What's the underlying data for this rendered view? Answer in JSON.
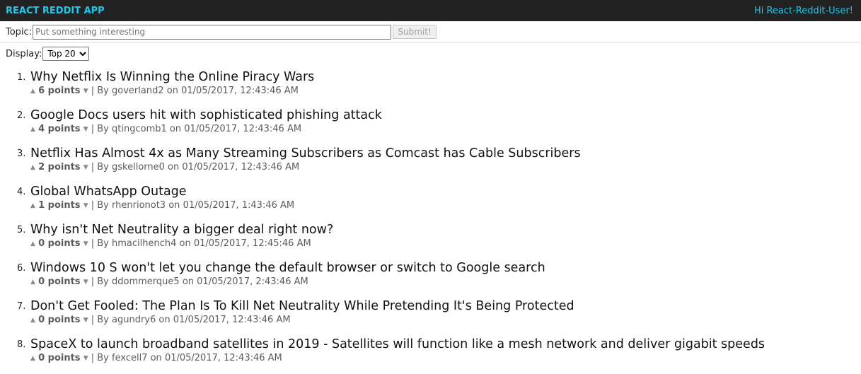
{
  "header": {
    "brand": "REACT REDDIT APP",
    "greeting": "Hi React-Reddit-User!",
    "accent_color": "#1ec8ee",
    "bar_color": "#222222"
  },
  "topic_form": {
    "label": "Topic:",
    "placeholder": "Put something interesting",
    "value": "",
    "submit_label": "Submit!"
  },
  "display": {
    "label": "Display:",
    "selected": "Top 20"
  },
  "vote_icons": {
    "up": "▲",
    "down": "▼"
  },
  "posts": [
    {
      "rank": "1.",
      "title": "Why Netflix Is Winning the Online Piracy Wars",
      "points": "6 points",
      "author": "goverland2",
      "date": "01/05/2017, 12:43:46 AM"
    },
    {
      "rank": "2.",
      "title": "Google Docs users hit with sophisticated phishing attack",
      "points": "4 points",
      "author": "qtingcomb1",
      "date": "01/05/2017, 12:43:46 AM"
    },
    {
      "rank": "3.",
      "title": "Netflix Has Almost 4x as Many Streaming Subscribers as Comcast has Cable Subscribers",
      "points": "2 points",
      "author": "gskellorne0",
      "date": "01/05/2017, 12:43:46 AM"
    },
    {
      "rank": "4.",
      "title": "Global WhatsApp Outage",
      "points": "1 points",
      "author": "rhenrionot3",
      "date": "01/05/2017, 1:43:46 AM"
    },
    {
      "rank": "5.",
      "title": "Why isn't Net Neutrality a bigger deal right now?",
      "points": "0 points",
      "author": "hmacilhench4",
      "date": "01/05/2017, 12:45:46 AM"
    },
    {
      "rank": "6.",
      "title": "Windows 10 S won't let you change the default browser or switch to Google search",
      "points": "0 points",
      "author": "ddommerque5",
      "date": "01/05/2017, 2:43:46 AM"
    },
    {
      "rank": "7.",
      "title": "Don't Get Fooled: The Plan Is To Kill Net Neutrality While Pretending It's Being Protected",
      "points": "0 points",
      "author": "agundry6",
      "date": "01/05/2017, 12:43:46 AM"
    },
    {
      "rank": "8.",
      "title": "SpaceX to launch broadband satellites in 2019 - Satellites will function like a mesh network and deliver gigabit speeds",
      "points": "0 points",
      "author": "fexcell7",
      "date": "01/05/2017, 12:43:46 AM"
    }
  ]
}
